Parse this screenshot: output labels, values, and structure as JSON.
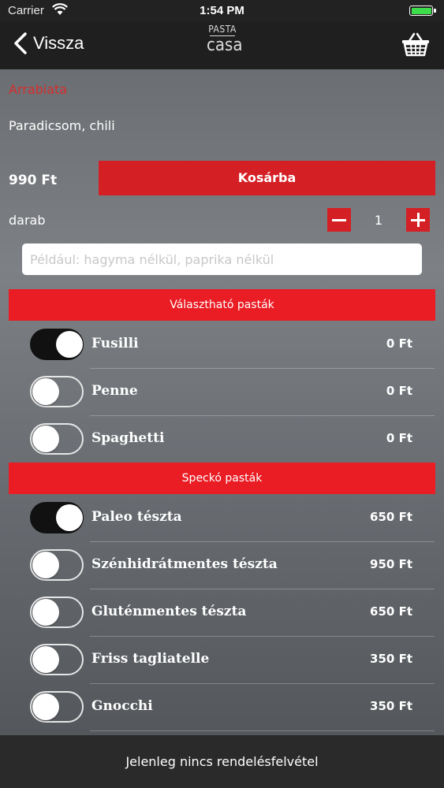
{
  "status": {
    "carrier": "Carrier",
    "time": "1:54 PM"
  },
  "nav": {
    "back_label": "Vissza",
    "logo_top": "PASTA",
    "logo_bottom": "casa"
  },
  "product": {
    "name": "Arrabiata",
    "ingredients": "Paradicsom, chili",
    "price": "990 Ft",
    "add_label": "Kosárba",
    "qty_label": "darab",
    "qty": "1",
    "note_placeholder": "Például: hagyma nélkül, paprika nélkül"
  },
  "sections": [
    {
      "title": "Választható pasták",
      "items": [
        {
          "name": "Fusilli",
          "price": "0 Ft",
          "on": true
        },
        {
          "name": "Penne",
          "price": "0 Ft",
          "on": false
        },
        {
          "name": "Spaghetti",
          "price": "0 Ft",
          "on": false
        }
      ]
    },
    {
      "title": "Speckó pasták",
      "items": [
        {
          "name": "Paleo tészta",
          "price": "650 Ft",
          "on": true
        },
        {
          "name": "Szénhidrátmentes tészta",
          "price": "950 Ft",
          "on": false
        },
        {
          "name": "Gluténmentes tészta",
          "price": "650 Ft",
          "on": false
        },
        {
          "name": "Friss tagliatelle",
          "price": "350 Ft",
          "on": false
        },
        {
          "name": "Gnocchi",
          "price": "350 Ft",
          "on": false
        }
      ]
    }
  ],
  "footer": {
    "text": "Jelenleg nincs rendelésfelvétel"
  },
  "colors": {
    "accent": "#ea1c24",
    "button": "#d41f25",
    "battery": "#3ddc4a"
  },
  "icons": [
    "wifi-icon",
    "battery-icon",
    "back-chevron-icon",
    "basket-icon",
    "minus-icon",
    "plus-icon"
  ]
}
